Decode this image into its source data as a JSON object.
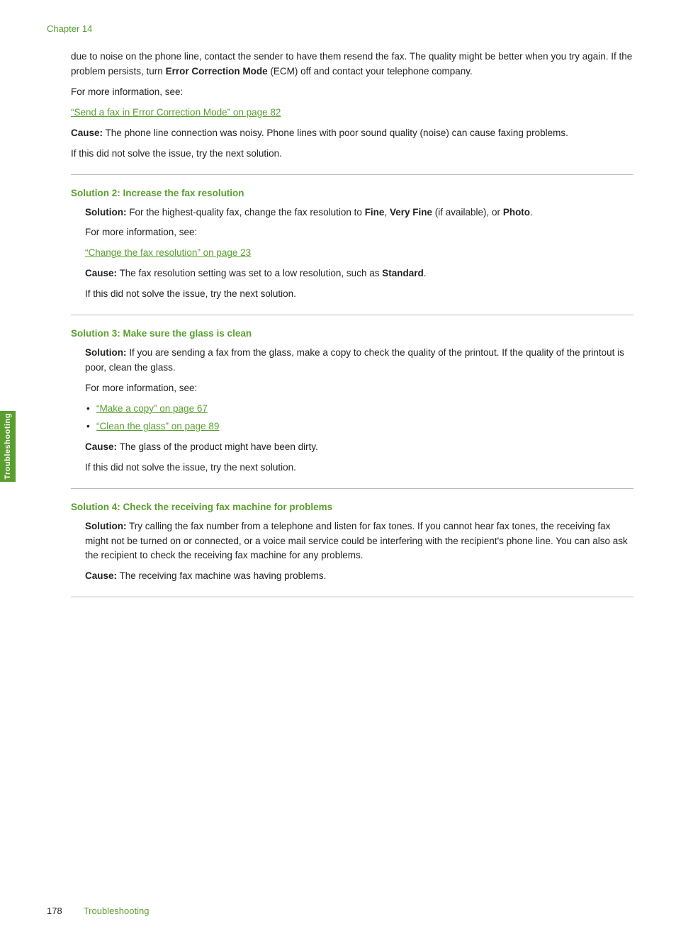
{
  "chapter": {
    "label": "Chapter 14"
  },
  "footer": {
    "page_number": "178",
    "section_label": "Troubleshooting"
  },
  "side_tab": {
    "label": "Troubleshooting"
  },
  "intro": {
    "para1": "due to noise on the phone line, contact the sender to have them resend the fax. The quality might be better when you try again. If the problem persists, turn ",
    "bold1": "Error Correction Mode",
    "para1b": " (ECM) off and contact your telephone company.",
    "for_more": "For more information, see:",
    "link1": "“Send a fax in Error Correction Mode” on page 82",
    "cause_label": "Cause:",
    "cause_text": "   The phone line connection was noisy. Phone lines with poor sound quality (noise) can cause faxing problems.",
    "next_solution": "If this did not solve the issue, try the next solution."
  },
  "solution2": {
    "heading": "Solution 2: Increase the fax resolution",
    "solution_label": "Solution:",
    "solution_text": "   For the highest-quality fax, change the fax resolution to ",
    "bold1": "Fine",
    "comma": ", ",
    "bold2": "Very Fine",
    "text2": " (if available), or ",
    "bold3": "Photo",
    "text3": ".",
    "for_more": "For more information, see:",
    "link": "“Change the fax resolution” on page 23",
    "cause_label": "Cause:",
    "cause_text": "   The fax resolution setting was set to a low resolution, such as ",
    "bold_cause": "Standard",
    "cause_end": ".",
    "next_solution": "If this did not solve the issue, try the next solution."
  },
  "solution3": {
    "heading": "Solution 3: Make sure the glass is clean",
    "solution_label": "Solution:",
    "solution_text": "   If you are sending a fax from the glass, make a copy to check the quality of the printout. If the quality of the printout is poor, clean the glass.",
    "for_more": "For more information, see:",
    "link1": "“Make a copy” on page 67",
    "link2": "“Clean the glass” on page 89",
    "cause_label": "Cause:",
    "cause_text": "   The glass of the product might have been dirty.",
    "next_solution": "If this did not solve the issue, try the next solution."
  },
  "solution4": {
    "heading": "Solution 4: Check the receiving fax machine for problems",
    "solution_label": "Solution:",
    "solution_text": "   Try calling the fax number from a telephone and listen for fax tones. If you cannot hear fax tones, the receiving fax might not be turned on or connected, or a voice mail service could be interfering with the recipient's phone line. You can also ask the recipient to check the receiving fax machine for any problems.",
    "cause_label": "Cause:",
    "cause_text": "   The receiving fax machine was having problems."
  }
}
